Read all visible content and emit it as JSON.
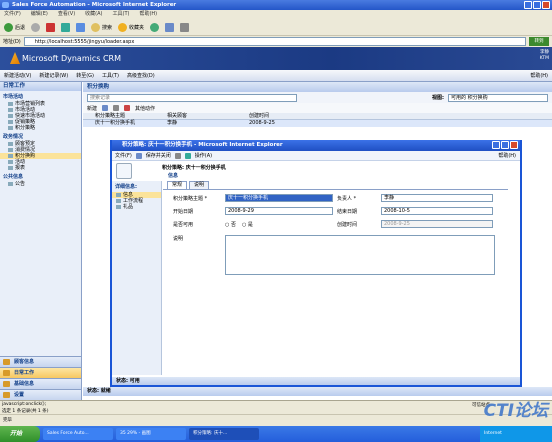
{
  "ie_title": "Sales Force Automation - Microsoft Internet Explorer",
  "ie_menu": [
    "文件(F)",
    "编辑(E)",
    "查看(V)",
    "收藏(A)",
    "工具(T)",
    "帮助(H)"
  ],
  "ie_toolbar": {
    "back": "后退",
    "search": "搜索",
    "favorites": "收藏夹"
  },
  "address": {
    "label": "地址(D)",
    "url": "http://localhost:5555/jingyu/loader.aspx",
    "go": "转到"
  },
  "crm": {
    "product": "Microsoft Dynamics CRM",
    "user_line1": "李静",
    "user_line2": "KTM"
  },
  "crm_menu": {
    "new_activity": "新建活动(V)",
    "new_record": "新建记录(W)",
    "goto": "转至(G)",
    "tools": "工具(T)",
    "advanced_find": "高级查找(D)",
    "help": "帮助(H)"
  },
  "leftnav": {
    "header": "日常工作",
    "sections": [
      {
        "title": "市场活动",
        "items": [
          "市场营销列表",
          "市场活动",
          "快速市场活动",
          "促销策略",
          "积分策略"
        ]
      },
      {
        "title": "政务情况",
        "items": [
          "顾客预定",
          "消费情况",
          "积分换购",
          "活动",
          "报表"
        ],
        "selected": 2
      },
      {
        "title": "公共信息",
        "items": [
          "公告"
        ]
      }
    ],
    "workspaces": [
      {
        "label": "顾客信息",
        "selected": false
      },
      {
        "label": "日常工作",
        "selected": true
      },
      {
        "label": "基础信息",
        "selected": false
      },
      {
        "label": "设置",
        "selected": false
      }
    ]
  },
  "main": {
    "title": "积分换购",
    "search_placeholder": "搜索记录",
    "view_label": "视图:",
    "view_value": "可用的 积分换购",
    "grid_toolbar": {
      "new": "新建",
      "more": "其他动作"
    },
    "columns": [
      "积分策略主题",
      "相关顾客",
      "创建时间"
    ],
    "rows": [
      {
        "subject": "庆十一积分换手机",
        "customer": "李静",
        "created": "2008-9-25"
      }
    ],
    "status": "状态: 就绪"
  },
  "popup": {
    "title": "积分策略: 庆十一积分换手机 - Microsoft Internet Explorer",
    "menu": {
      "file": "文件(F)",
      "save_close": "保存并关闭",
      "actions": "操作(A)",
      "help": "帮助(H)"
    },
    "header_line": "积分策略: 庆十一积分换手机",
    "header_sub": "信息",
    "nav_header": "详细信息:",
    "nav_items": [
      "信息",
      "工作流程",
      "礼品"
    ],
    "tabs": [
      "常规",
      "说明"
    ],
    "fields": {
      "subject_label": "积分策略主题 *",
      "subject_value": "庆十一积分换手机",
      "owner_label": "负责人 *",
      "owner_value": "李静",
      "start_label": "开始日期",
      "start_value": "2008-9-29",
      "end_label": "结束日期",
      "end_value": "2008-10-5",
      "enabled_label": "是否可用",
      "opt_no": "否",
      "opt_yes": "是",
      "created_label": "创建时间",
      "created_value": "2008-9-25",
      "desc_label": "说明"
    },
    "status": "状态: 可用"
  },
  "ie_status": {
    "left": "javascript:onclick();",
    "selection": "选定 1 条记录(共 1 条)",
    "zone": "可信站点",
    "done": "完毕"
  },
  "taskbar": {
    "start": "开始",
    "tasks": [
      "Sales Force Auto...",
      "35 29% - 画图",
      "积分策略: 庆十..."
    ],
    "tray": "Internet"
  },
  "watermark": "CTI论坛"
}
